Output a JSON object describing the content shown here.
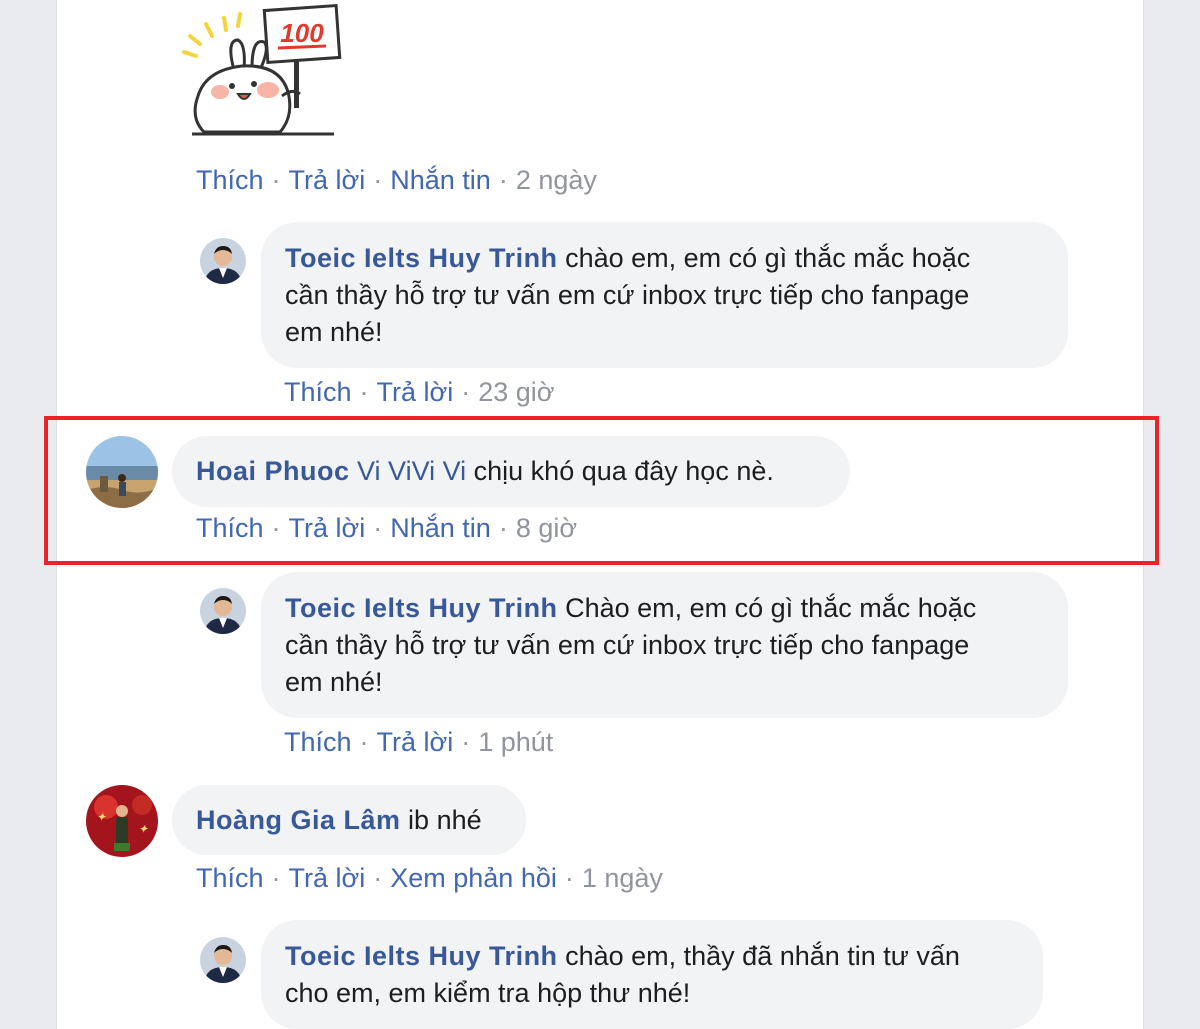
{
  "comments": [
    {
      "id": "c0",
      "actions": {
        "like": "Thích",
        "reply": "Trả lời",
        "message": "Nhắn tin",
        "time": "2 ngày"
      },
      "sticker": {
        "text": "100",
        "icon": "bunny-100-sticker"
      }
    },
    {
      "id": "r1",
      "author": "Toeic Ielts Huy Trinh",
      "lines": [
        "chào em, em có gì thắc mắc hoặc",
        "cần thầy hỗ trợ tư vấn em cứ inbox trực tiếp cho fanpage",
        "em nhé!"
      ],
      "actions": {
        "like": "Thích",
        "reply": "Trả lời",
        "time": "23 giờ"
      }
    },
    {
      "id": "c2",
      "author": "Hoai Phuoc",
      "mention": "Vi ViVi Vi",
      "text": "chịu khó qua đây học nè.",
      "actions": {
        "like": "Thích",
        "reply": "Trả lời",
        "message": "Nhắn tin",
        "time": "8 giờ"
      }
    },
    {
      "id": "r3",
      "author": "Toeic Ielts Huy Trinh",
      "lines": [
        "Chào em, em có gì thắc mắc hoặc",
        "cần thầy hỗ trợ tư vấn em cứ inbox trực tiếp cho fanpage",
        "em nhé!"
      ],
      "actions": {
        "like": "Thích",
        "reply": "Trả lời",
        "time": "1 phút"
      }
    },
    {
      "id": "c4",
      "author": "Hoàng Gia Lâm",
      "text": "ib nhé",
      "actions": {
        "like": "Thích",
        "reply": "Trả lời",
        "view_replies": "Xem phản hồi",
        "time": "1 ngày"
      }
    },
    {
      "id": "r5",
      "author": "Toeic Ielts Huy Trinh",
      "lines": [
        "chào em, thầy đã nhắn tin tư vấn",
        "cho em, em kiểm tra hộp thư nhé!"
      ]
    }
  ],
  "colors": {
    "link": "#4267b2",
    "name": "#385898",
    "bubble": "#f2f3f5",
    "highlight": "#e8232a",
    "muted": "#90949c"
  }
}
